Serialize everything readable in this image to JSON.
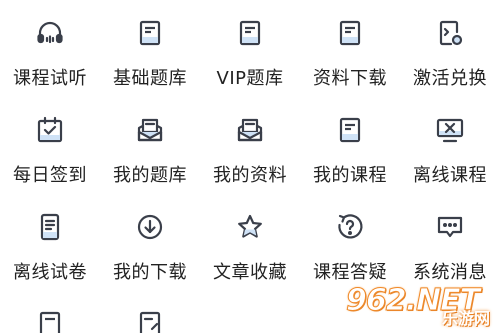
{
  "menu": {
    "items": [
      {
        "label": "课程试听",
        "icon": "headphones-icon"
      },
      {
        "label": "基础题库",
        "icon": "book-icon"
      },
      {
        "label": "VIP题库",
        "icon": "book-icon"
      },
      {
        "label": "资料下载",
        "icon": "book-icon"
      },
      {
        "label": "激活兑换",
        "icon": "activate-icon"
      },
      {
        "label": "每日签到",
        "icon": "calendar-check-icon"
      },
      {
        "label": "我的题库",
        "icon": "envelope-icon"
      },
      {
        "label": "我的资料",
        "icon": "envelope-icon"
      },
      {
        "label": "我的课程",
        "icon": "book-icon"
      },
      {
        "label": "离线课程",
        "icon": "offline-monitor-icon"
      },
      {
        "label": "离线试卷",
        "icon": "paper-icon"
      },
      {
        "label": "我的下载",
        "icon": "download-icon"
      },
      {
        "label": "文章收藏",
        "icon": "star-icon"
      },
      {
        "label": "课程答疑",
        "icon": "question-icon"
      },
      {
        "label": "系统消息",
        "icon": "message-icon"
      }
    ]
  },
  "watermark": {
    "brand": "962.NET",
    "sub": "乐游网"
  },
  "colors": {
    "icon_stroke": "#3a3f4a",
    "icon_fill": "#cfe2f6",
    "label": "#222222"
  }
}
